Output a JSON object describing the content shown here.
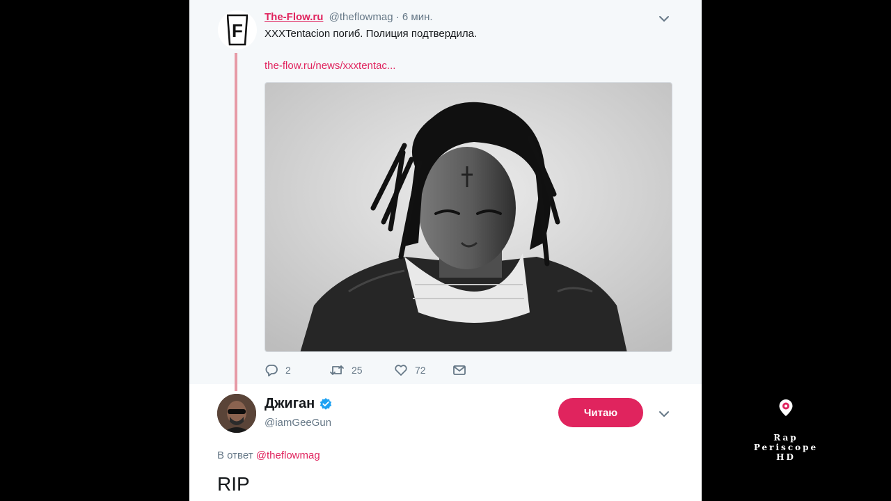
{
  "parent_tweet": {
    "author_name": "The-Flow.ru",
    "author_handle": "@theflowmag",
    "time": "· 6 мин.",
    "text": "XXXTentacion погиб. Полиция подтвердила.",
    "link": "the-flow.ru/news/xxxtentac...",
    "avatar_letter": "F",
    "counts": {
      "replies": "2",
      "retweets": "25",
      "likes": "72"
    }
  },
  "reply_tweet": {
    "author_name": "Джиган",
    "author_handle": "@iamGeeGun",
    "follow_label": "Читаю",
    "reply_prefix": "В ответ",
    "reply_mention": "@theflowmag",
    "text": "RIP"
  },
  "watermark": {
    "line1": "Rap",
    "line2": "Periscope",
    "line3": "HD"
  },
  "colors": {
    "accent": "#e0245e",
    "thread_line": "#e69aa6",
    "verified": "#1da1f2",
    "muted_text": "#657786"
  },
  "icons": [
    "chevron-down-icon",
    "reply-icon",
    "retweet-icon",
    "like-icon",
    "direct-message-icon",
    "verified-badge-icon",
    "periscope-pin-icon"
  ]
}
